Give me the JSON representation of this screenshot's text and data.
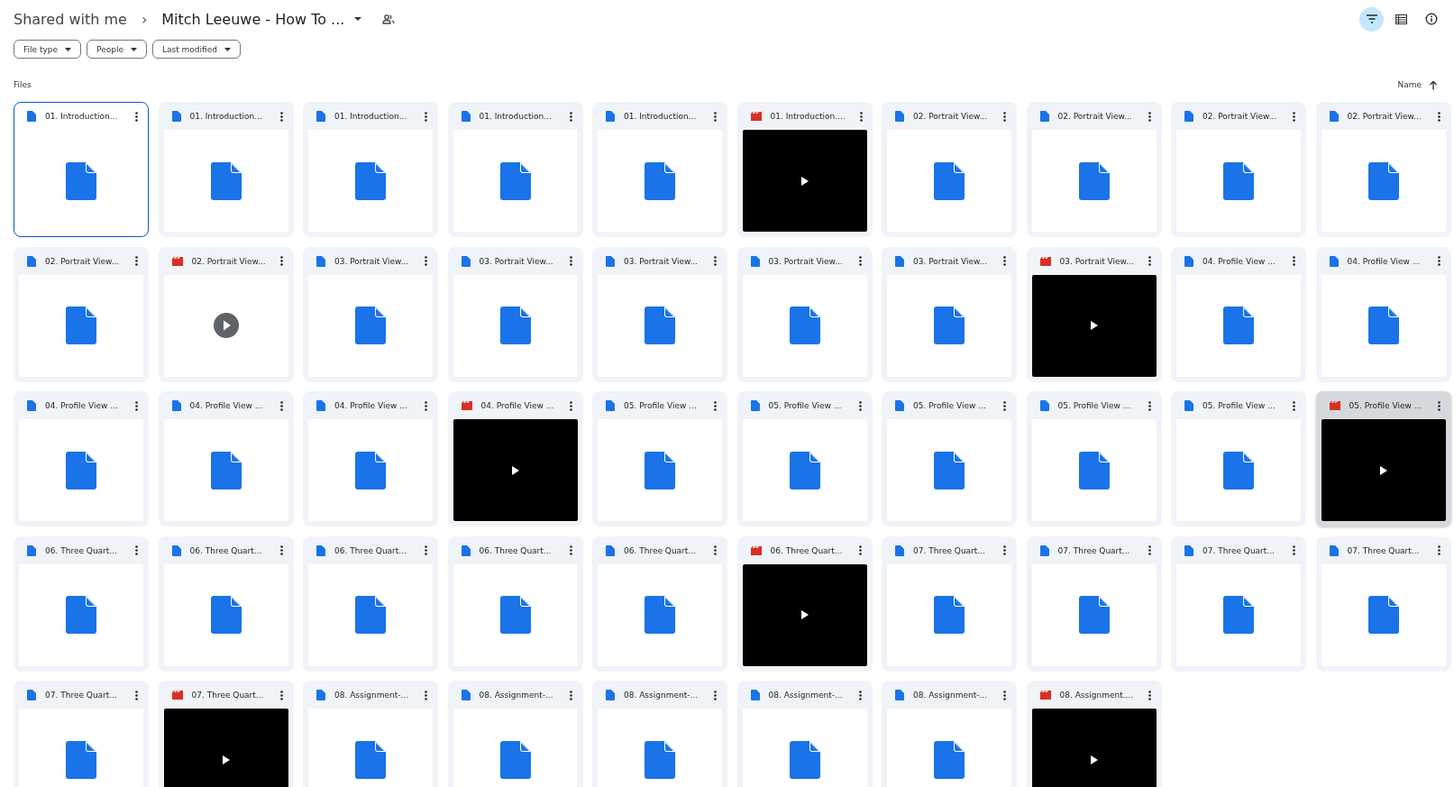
{
  "breadcrumb": {
    "root": "Shared with me",
    "separator": "›",
    "current": "Mitch Leeuwe - How To ..."
  },
  "toolbar": {
    "filter_selected": true
  },
  "filters": [
    "File type",
    "People",
    "Last modified"
  ],
  "section_label": "Files",
  "sort": {
    "label": "Name",
    "ascending": true
  },
  "files": [
    {
      "title": "01. Introduction...",
      "kind": "doc",
      "selected": true,
      "hovered": false
    },
    {
      "title": "01. Introduction...",
      "kind": "doc",
      "selected": false,
      "hovered": false
    },
    {
      "title": "01. Introduction...",
      "kind": "doc",
      "selected": false,
      "hovered": false
    },
    {
      "title": "01. Introduction...",
      "kind": "doc",
      "selected": false,
      "hovered": false
    },
    {
      "title": "01. Introduction...",
      "kind": "doc",
      "selected": false,
      "hovered": false
    },
    {
      "title": "01. Introduction....",
      "kind": "video",
      "selected": false,
      "hovered": false
    },
    {
      "title": "02. Portrait View...",
      "kind": "doc",
      "selected": false,
      "hovered": false
    },
    {
      "title": "02. Portrait View...",
      "kind": "doc",
      "selected": false,
      "hovered": false
    },
    {
      "title": "02. Portrait View...",
      "kind": "doc",
      "selected": false,
      "hovered": false
    },
    {
      "title": "02. Portrait View...",
      "kind": "doc",
      "selected": false,
      "hovered": false
    },
    {
      "title": "02. Portrait View...",
      "kind": "doc",
      "selected": false,
      "hovered": false
    },
    {
      "title": "02. Portrait View...",
      "kind": "video_pending",
      "selected": false,
      "hovered": false
    },
    {
      "title": "03. Portrait View...",
      "kind": "doc",
      "selected": false,
      "hovered": false
    },
    {
      "title": "03. Portrait View...",
      "kind": "doc",
      "selected": false,
      "hovered": false
    },
    {
      "title": "03. Portrait View...",
      "kind": "doc",
      "selected": false,
      "hovered": false
    },
    {
      "title": "03. Portrait View...",
      "kind": "doc",
      "selected": false,
      "hovered": false
    },
    {
      "title": "03. Portrait View...",
      "kind": "doc",
      "selected": false,
      "hovered": false
    },
    {
      "title": "03. Portrait View...",
      "kind": "video",
      "selected": false,
      "hovered": false
    },
    {
      "title": "04. Profile View ...",
      "kind": "doc",
      "selected": false,
      "hovered": false
    },
    {
      "title": "04. Profile View ...",
      "kind": "doc",
      "selected": false,
      "hovered": false
    },
    {
      "title": "04. Profile View ...",
      "kind": "doc",
      "selected": false,
      "hovered": false
    },
    {
      "title": "04. Profile View ...",
      "kind": "doc",
      "selected": false,
      "hovered": false
    },
    {
      "title": "04. Profile View ...",
      "kind": "doc",
      "selected": false,
      "hovered": false
    },
    {
      "title": "04. Profile View ...",
      "kind": "video",
      "selected": false,
      "hovered": false
    },
    {
      "title": "05. Profile View ...",
      "kind": "doc",
      "selected": false,
      "hovered": false
    },
    {
      "title": "05. Profile View ...",
      "kind": "doc",
      "selected": false,
      "hovered": false
    },
    {
      "title": "05. Profile View ...",
      "kind": "doc",
      "selected": false,
      "hovered": false
    },
    {
      "title": "05. Profile View ...",
      "kind": "doc",
      "selected": false,
      "hovered": false
    },
    {
      "title": "05. Profile View ...",
      "kind": "doc",
      "selected": false,
      "hovered": false
    },
    {
      "title": "05. Profile View ...",
      "kind": "video",
      "selected": false,
      "hovered": true
    },
    {
      "title": "06. Three Quart...",
      "kind": "doc",
      "selected": false,
      "hovered": false
    },
    {
      "title": "06. Three Quart...",
      "kind": "doc",
      "selected": false,
      "hovered": false
    },
    {
      "title": "06. Three Quart...",
      "kind": "doc",
      "selected": false,
      "hovered": false
    },
    {
      "title": "06. Three Quart...",
      "kind": "doc",
      "selected": false,
      "hovered": false
    },
    {
      "title": "06. Three Quart...",
      "kind": "doc",
      "selected": false,
      "hovered": false
    },
    {
      "title": "06. Three Quart...",
      "kind": "video",
      "selected": false,
      "hovered": false
    },
    {
      "title": "07. Three Quart...",
      "kind": "doc",
      "selected": false,
      "hovered": false
    },
    {
      "title": "07. Three Quart...",
      "kind": "doc",
      "selected": false,
      "hovered": false
    },
    {
      "title": "07. Three Quart...",
      "kind": "doc",
      "selected": false,
      "hovered": false
    },
    {
      "title": "07. Three Quart...",
      "kind": "doc",
      "selected": false,
      "hovered": false
    },
    {
      "title": "07. Three Quart...",
      "kind": "doc",
      "selected": false,
      "hovered": false
    },
    {
      "title": "07. Three Quart...",
      "kind": "video",
      "selected": false,
      "hovered": false
    },
    {
      "title": "08. Assignment-...",
      "kind": "doc",
      "selected": false,
      "hovered": false
    },
    {
      "title": "08. Assignment-...",
      "kind": "doc",
      "selected": false,
      "hovered": false
    },
    {
      "title": "08. Assignment-...",
      "kind": "doc",
      "selected": false,
      "hovered": false
    },
    {
      "title": "08. Assignment-...",
      "kind": "doc",
      "selected": false,
      "hovered": false
    },
    {
      "title": "08. Assignment-...",
      "kind": "doc",
      "selected": false,
      "hovered": false
    },
    {
      "title": "08. Assignment....",
      "kind": "video",
      "selected": false,
      "hovered": false
    }
  ]
}
